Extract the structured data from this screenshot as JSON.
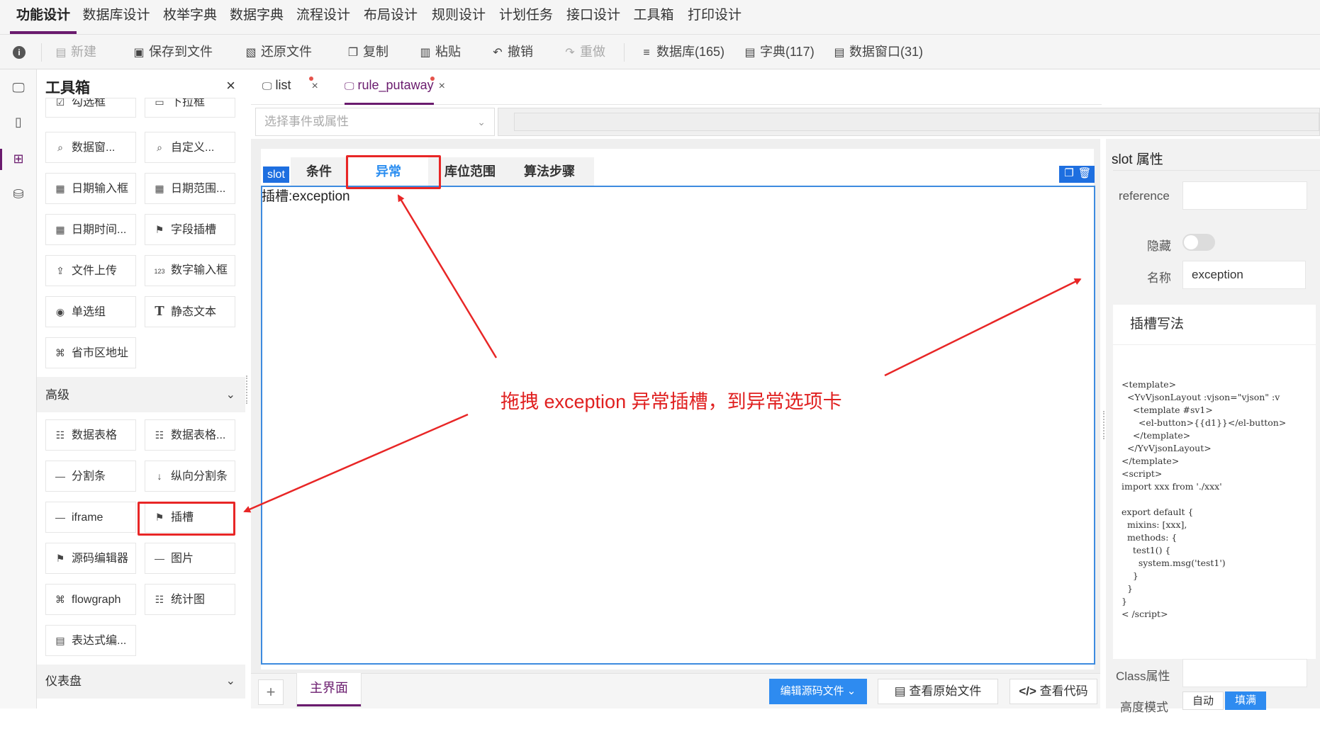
{
  "top_menu": [
    "功能设计",
    "数据库设计",
    "枚举字典",
    "数据字典",
    "流程设计",
    "布局设计",
    "规则设计",
    "计划任务",
    "接口设计",
    "工具箱",
    "打印设计"
  ],
  "toolbar": {
    "info": "i",
    "new": "新建",
    "save_file": "保存到文件",
    "restore_file": "还原文件",
    "copy": "复制",
    "paste": "粘贴",
    "undo": "撤销",
    "redo": "重做",
    "database": "数据库(165)",
    "dictionary": "字典(117)",
    "data_window": "数据窗口(31)"
  },
  "toolbox": {
    "title": "工具箱",
    "close": "×",
    "basic_tools": [
      "勾选框",
      "下拉框",
      "数据窗...",
      "自定义...",
      "日期输入框",
      "日期范围...",
      "日期时间...",
      "字段插槽",
      "文件上传",
      "数字输入框",
      "单选组",
      "静态文本",
      "省市区地址"
    ],
    "sections": {
      "advanced": "高级",
      "dashboard": "仪表盘"
    },
    "advanced_tools": [
      "数据表格",
      "数据表格...",
      "分割条",
      "纵向分割条",
      "iframe",
      "插槽",
      "源码编辑器",
      "图片",
      "flowgraph",
      "统计图",
      "表达式编..."
    ]
  },
  "designer": {
    "tabs": [
      {
        "label": "list",
        "close": "×"
      },
      {
        "label": "rule_putaway",
        "close": "×"
      }
    ],
    "event_select_placeholder": "选择事件或属性",
    "slot_tag": "slot",
    "inner_tabs": [
      "条件",
      "异常",
      "库位范围",
      "算法步骤"
    ],
    "slot_label": "插槽:exception",
    "annotation": "拖拽 exception 异常插槽，到异常选项卡"
  },
  "bottom": {
    "add": "+",
    "main_tab": "主界面",
    "edit_source": "编辑源码文件",
    "view_original": "查看原始文件",
    "view_code": "查看代码"
  },
  "props": {
    "title": "slot 属性",
    "reference_label": "reference",
    "reference_value": "",
    "hidden_label": "隐藏",
    "hidden_on": false,
    "name_label": "名称",
    "name_value": "exception",
    "slot_usage_title": "插槽写法",
    "code": "<template>\n  <YvVjsonLayout :vjson=\"vjson\" :v\n    <template #sv1>\n      <el-button>{{d1}}</el-button>\n    </template>\n  </YvVjsonLayout>\n</template>\n<script>\nimport xxx from './xxx'\n\nexport default {\n  mixins: [xxx],\n  methods: {\n    test1() {\n      system.msg('test1')\n    }\n  }\n}\n< /script>",
    "class_label": "Class属性",
    "height_mode_label": "高度模式",
    "height_modes": [
      "自动",
      "填满"
    ],
    "height_mode_selected": "填满"
  },
  "colors": {
    "accent": "#6a1b6e",
    "primary": "#2e8bf0",
    "annotation": "#e02020"
  }
}
